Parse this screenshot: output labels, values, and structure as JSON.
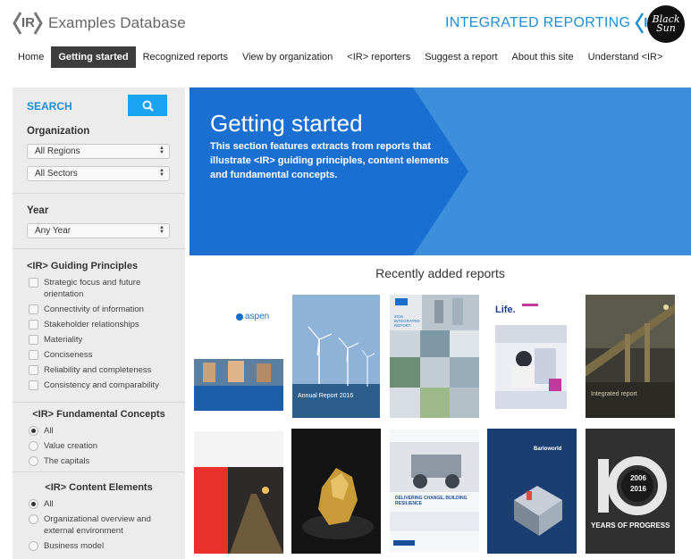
{
  "header": {
    "site_title": "Examples Database",
    "ir_mark": "IR",
    "brand_text": "INTEGRATED REPORTING",
    "brand_mark": "IR",
    "badge_text": "Black Sun"
  },
  "nav": {
    "items": [
      {
        "label": "Home"
      },
      {
        "label": "Getting started",
        "active": true
      },
      {
        "label": "Recognized reports"
      },
      {
        "label": "View by organization"
      },
      {
        "label": "<IR> reporters"
      },
      {
        "label": "Suggest a report"
      },
      {
        "label": "About this site"
      },
      {
        "label": "Understand <IR>"
      }
    ]
  },
  "sidebar": {
    "search_label": "SEARCH",
    "organization_label": "Organization",
    "regions_value": "All Regions",
    "sectors_value": "All Sectors",
    "year_label": "Year",
    "year_value": "Any Year",
    "guiding_label": "<IR> Guiding Principles",
    "guiding": [
      "Strategic focus and future orientation",
      "Connectivity of information",
      "Stakeholder relationships",
      "Materiality",
      "Conciseness",
      "Reliability and completeness",
      "Consistency and comparability"
    ],
    "fundamental_label": "<IR> Fundamental Concepts",
    "fundamental": [
      "All",
      "Value creation",
      "The capitals"
    ],
    "content_label": "<IR> Content Elements",
    "content": [
      "All",
      "Organizational overview and external environment",
      "Business model"
    ]
  },
  "hero": {
    "title": "Getting started",
    "text": "This section features extracts from reports that illustrate <IR> guiding principles, content elements and fundamental concepts."
  },
  "recent": {
    "title": "Recently added reports",
    "covers": [
      {
        "name": "aspen",
        "brand": "aspen"
      },
      {
        "name": "wind-turbines",
        "caption": "Annual Report 2016"
      },
      {
        "name": "transnet",
        "caption": "2016 INTEGRATED REPORT"
      },
      {
        "name": "liberty",
        "brand": "Life."
      },
      {
        "name": "conveyor-night",
        "caption": "Integrated report"
      },
      {
        "name": "red-cover"
      },
      {
        "name": "gold-nugget"
      },
      {
        "name": "anglo-american",
        "caption": "DELIVERING CHANGE, BUILDING RESILIENCE"
      },
      {
        "name": "barloworld",
        "brand": "Barloworld"
      },
      {
        "name": "ten-years",
        "caption": "YEARS OF PROGRESS",
        "years": "2006 2016"
      }
    ]
  },
  "colors": {
    "accent": "#1a8fd8",
    "hero": "#1a76d2",
    "nav_active": "#3d3d3d"
  }
}
